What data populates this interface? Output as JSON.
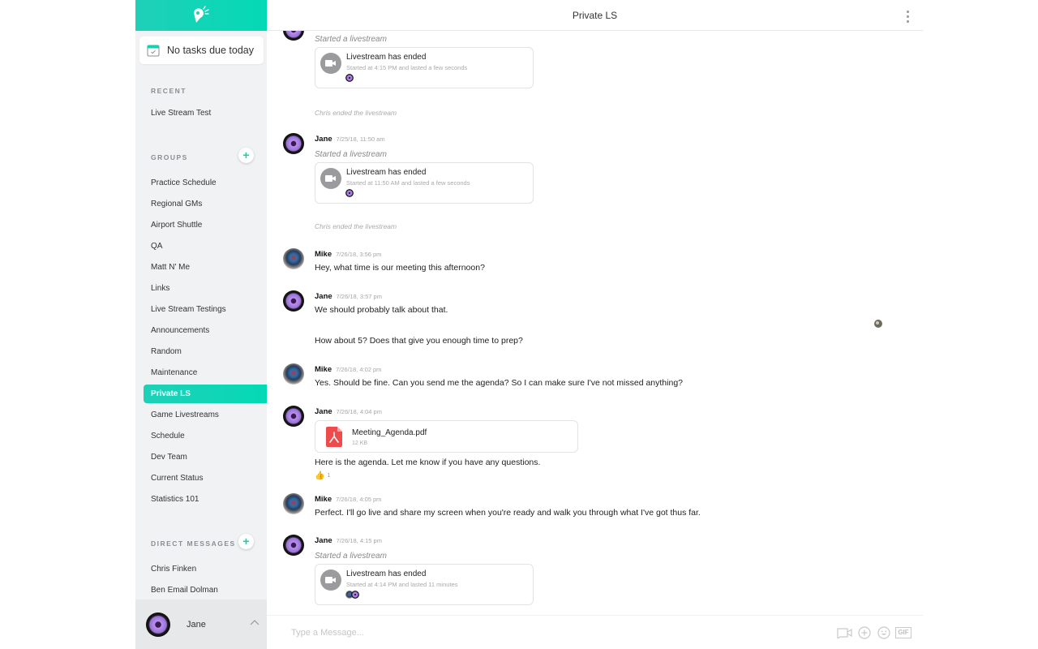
{
  "sidebar": {
    "tasks_label": "No tasks due today",
    "recent": {
      "title": "RECENT",
      "items": [
        {
          "label": "Live Stream Test"
        }
      ]
    },
    "groups": {
      "title": "GROUPS",
      "add_label": "+",
      "items": [
        {
          "label": "Practice Schedule"
        },
        {
          "label": "Regional GMs"
        },
        {
          "label": "Airport Shuttle"
        },
        {
          "label": "QA"
        },
        {
          "label": "Matt N' Me"
        },
        {
          "label": "Links"
        },
        {
          "label": "Live Stream Testings"
        },
        {
          "label": "Announcements"
        },
        {
          "label": "Random"
        },
        {
          "label": "Maintenance"
        },
        {
          "label": "Private LS",
          "active": true
        },
        {
          "label": "Game Livestreams"
        },
        {
          "label": "Schedule"
        },
        {
          "label": "Dev Team"
        },
        {
          "label": "Current Status"
        },
        {
          "label": "Statistics 101"
        }
      ]
    },
    "direct_messages": {
      "title": "DIRECT MESSAGES",
      "add_label": "+",
      "items": [
        {
          "label": "Chris Finken"
        },
        {
          "label": "Ben Email Dolman"
        }
      ]
    },
    "current_user": {
      "name": "Jane"
    }
  },
  "header": {
    "title": "Private LS"
  },
  "messages": [
    {
      "type": "livestream",
      "action": "Started a livestream",
      "card_title": "Livestream has ended",
      "card_subtitle": "Started at 4:15 PM and lasted a few seconds",
      "ended_note": "Chris ended the livestream"
    },
    {
      "type": "livestream",
      "author": "Jane",
      "timestamp": "7/25/18, 11:50 am",
      "action": "Started a livestream",
      "card_title": "Livestream has ended",
      "card_subtitle": "Started at 11:50 AM and lasted a few seconds",
      "ended_note": "Chris ended the livestream"
    },
    {
      "type": "text",
      "author": "Mike",
      "timestamp": "7/26/18, 3:56 pm",
      "text": "Hey, what time is our meeting this afternoon?"
    },
    {
      "type": "text",
      "author": "Jane",
      "timestamp": "7/26/18, 3:57 pm",
      "text": "We should probably talk about that.",
      "text2": "How about 5?  Does that give you enough time to prep?"
    },
    {
      "type": "text",
      "author": "Mike",
      "timestamp": "7/26/18, 4:02 pm",
      "text": "Yes.  Should be fine.  Can you send me the agenda?  So I can make sure I've not missed anything?"
    },
    {
      "type": "file",
      "author": "Jane",
      "timestamp": "7/26/18, 4:04 pm",
      "file_name": "Meeting_Agenda.pdf",
      "file_size": "12 KB",
      "text": "Here is the agenda.  Let me know if you have any questions.",
      "reaction": {
        "emoji": "👍",
        "count": "1"
      }
    },
    {
      "type": "text",
      "author": "Mike",
      "timestamp": "7/26/18, 4:05 pm",
      "text": "Perfect.  I'll go live and share my screen when you're ready and walk you through what I've got thus far."
    },
    {
      "type": "livestream",
      "author": "Jane",
      "timestamp": "7/26/18, 4:15 pm",
      "action": "Started a livestream",
      "card_title": "Livestream has ended",
      "card_subtitle": "Started at 4:14 PM and lasted 11 minutes"
    }
  ],
  "composer": {
    "placeholder": "Type a Message...",
    "value": "",
    "gif_label": "GIF"
  },
  "colors": {
    "accent": "#04d9b5",
    "sidebar_bg": "#f1f2f4",
    "pdf_red": "#ef4b4b"
  }
}
